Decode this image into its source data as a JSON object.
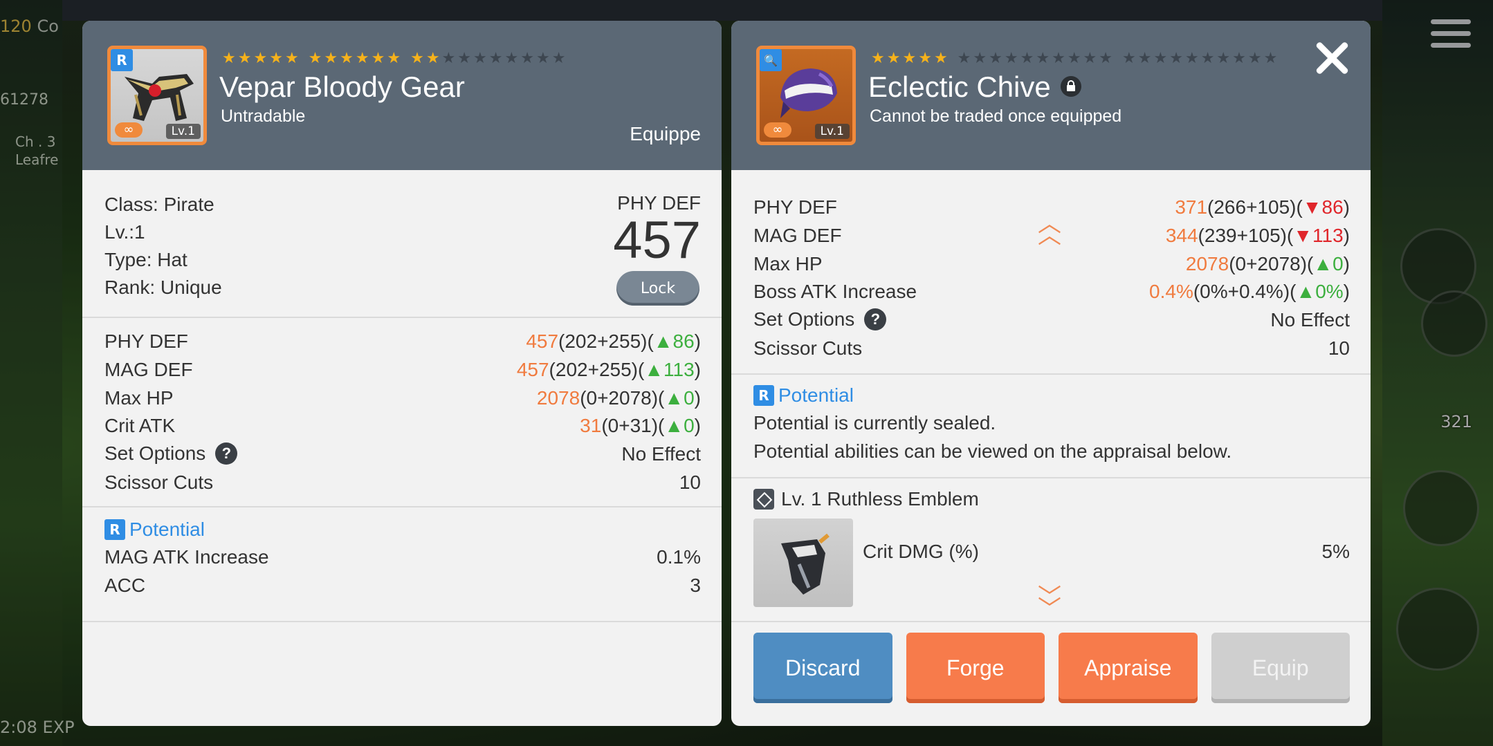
{
  "hud": {
    "level": "120",
    "level_suffix": "Co",
    "power": "61278",
    "channel": "Ch . 3",
    "map": "Leafre",
    "exp": "2:08 EXP",
    "potion_count": "321"
  },
  "left_panel": {
    "rank_badge": "R",
    "item_level_badge": "Lv.1",
    "infinity_badge": "∞",
    "stars": {
      "filled": 13,
      "total": 21,
      "groups": [
        5,
        6,
        10
      ]
    },
    "name": "Vepar Bloody Gear",
    "subtitle": "Untradable",
    "equip_label": "Equippe",
    "info": {
      "class": "Class: Pirate",
      "level": "Lv.:1",
      "type": "Type: Hat",
      "rank": "Rank: Unique"
    },
    "main_stat_label": "PHY DEF",
    "main_stat_value": "457",
    "lock_label": "Lock",
    "stats": [
      {
        "label": "PHY DEF",
        "value": "457",
        "detail": "(202+255)(",
        "arrow": "▲",
        "diff": "86",
        "close": ")"
      },
      {
        "label": "MAG DEF",
        "value": "457",
        "detail": "(202+255)(",
        "arrow": "▲",
        "diff": "113",
        "close": ")"
      },
      {
        "label": "Max HP",
        "value": "2078",
        "detail": "(0+2078)(",
        "arrow": "▲",
        "diff": "0",
        "close": ")"
      },
      {
        "label": "Crit ATK",
        "value": "31",
        "detail": "(0+31)(",
        "arrow": "▲",
        "diff": "0",
        "close": ")"
      }
    ],
    "set_options_label": "Set Options",
    "set_options_value": "No Effect",
    "scissor_label": "Scissor Cuts",
    "scissor_value": "10",
    "potential_badge": "R",
    "potential_label": "Potential",
    "potential_lines": [
      {
        "label": "MAG ATK Increase",
        "value": "0.1%"
      },
      {
        "label": "ACC",
        "value": "3"
      }
    ]
  },
  "right_panel": {
    "search_badge": "🔍",
    "item_level_badge": "Lv.1",
    "infinity_badge": "∞",
    "stars": {
      "filled": 5,
      "total": 25,
      "groups": [
        5,
        10,
        10
      ]
    },
    "name": "Eclectic Chive",
    "subtitle": "Cannot be traded once equipped",
    "stats": [
      {
        "label": "PHY DEF",
        "value": "371",
        "detail": "(266+105)(",
        "arrow": "▼",
        "diff": "86",
        "close": ")"
      },
      {
        "label": "MAG DEF",
        "value": "344",
        "detail": "(239+105)(",
        "arrow": "▼",
        "diff": "113",
        "close": ")"
      },
      {
        "label": "Max HP",
        "value": "2078",
        "detail": "(0+2078)(",
        "arrow": "▲",
        "diff": "0",
        "close": ")"
      },
      {
        "label": "Boss ATK Increase",
        "value": "0.4%",
        "detail": "(0%+0.4%)(",
        "arrow": "▲",
        "diff": "0%",
        "close": ")"
      }
    ],
    "set_options_label": "Set Options",
    "set_options_value": "No Effect",
    "scissor_label": "Scissor Cuts",
    "scissor_value": "10",
    "potential_badge": "R",
    "potential_label": "Potential",
    "potential_sealed": "Potential is currently sealed.",
    "potential_hint": "Potential abilities can be viewed on the appraisal below.",
    "emblem_title": "Lv. 1 Ruthless Emblem",
    "emblem_stat_label": "Crit DMG (%)",
    "emblem_stat_value": "5%",
    "buttons": {
      "discard": "Discard",
      "forge": "Forge",
      "appraise": "Appraise",
      "equip": "Equip"
    }
  },
  "colors": {
    "header": "#5b6875",
    "highlight": "#f07b3f",
    "up": "#3caf3e",
    "down": "#e0262b",
    "potential": "#2f8de4"
  }
}
